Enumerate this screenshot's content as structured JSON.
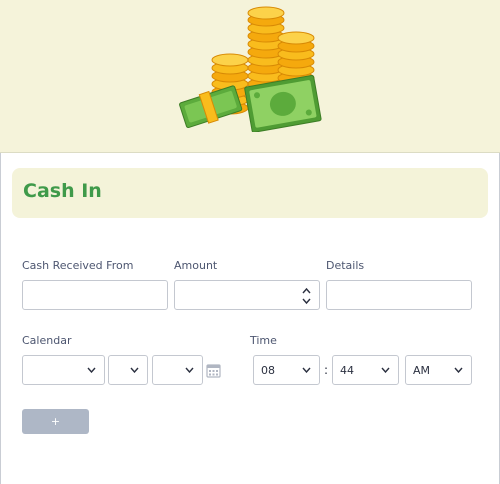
{
  "header": {
    "image_icon": "cash-money-illustration"
  },
  "title": "Cash In",
  "fields": {
    "cash_received_from": {
      "label": "Cash Received From",
      "value": ""
    },
    "amount": {
      "label": "Amount",
      "value": ""
    },
    "details": {
      "label": "Details",
      "value": ""
    }
  },
  "calendar": {
    "label": "Calendar",
    "month": "",
    "day": "",
    "year": ""
  },
  "time": {
    "label": "Time",
    "hour": "08",
    "separator": ":",
    "minute": "44",
    "period": "AM"
  },
  "add_button": {
    "label": "+"
  },
  "colors": {
    "title": "#3f9a4a",
    "banner_bg": "#f5f3da",
    "button_bg": "#aeb7c6"
  }
}
